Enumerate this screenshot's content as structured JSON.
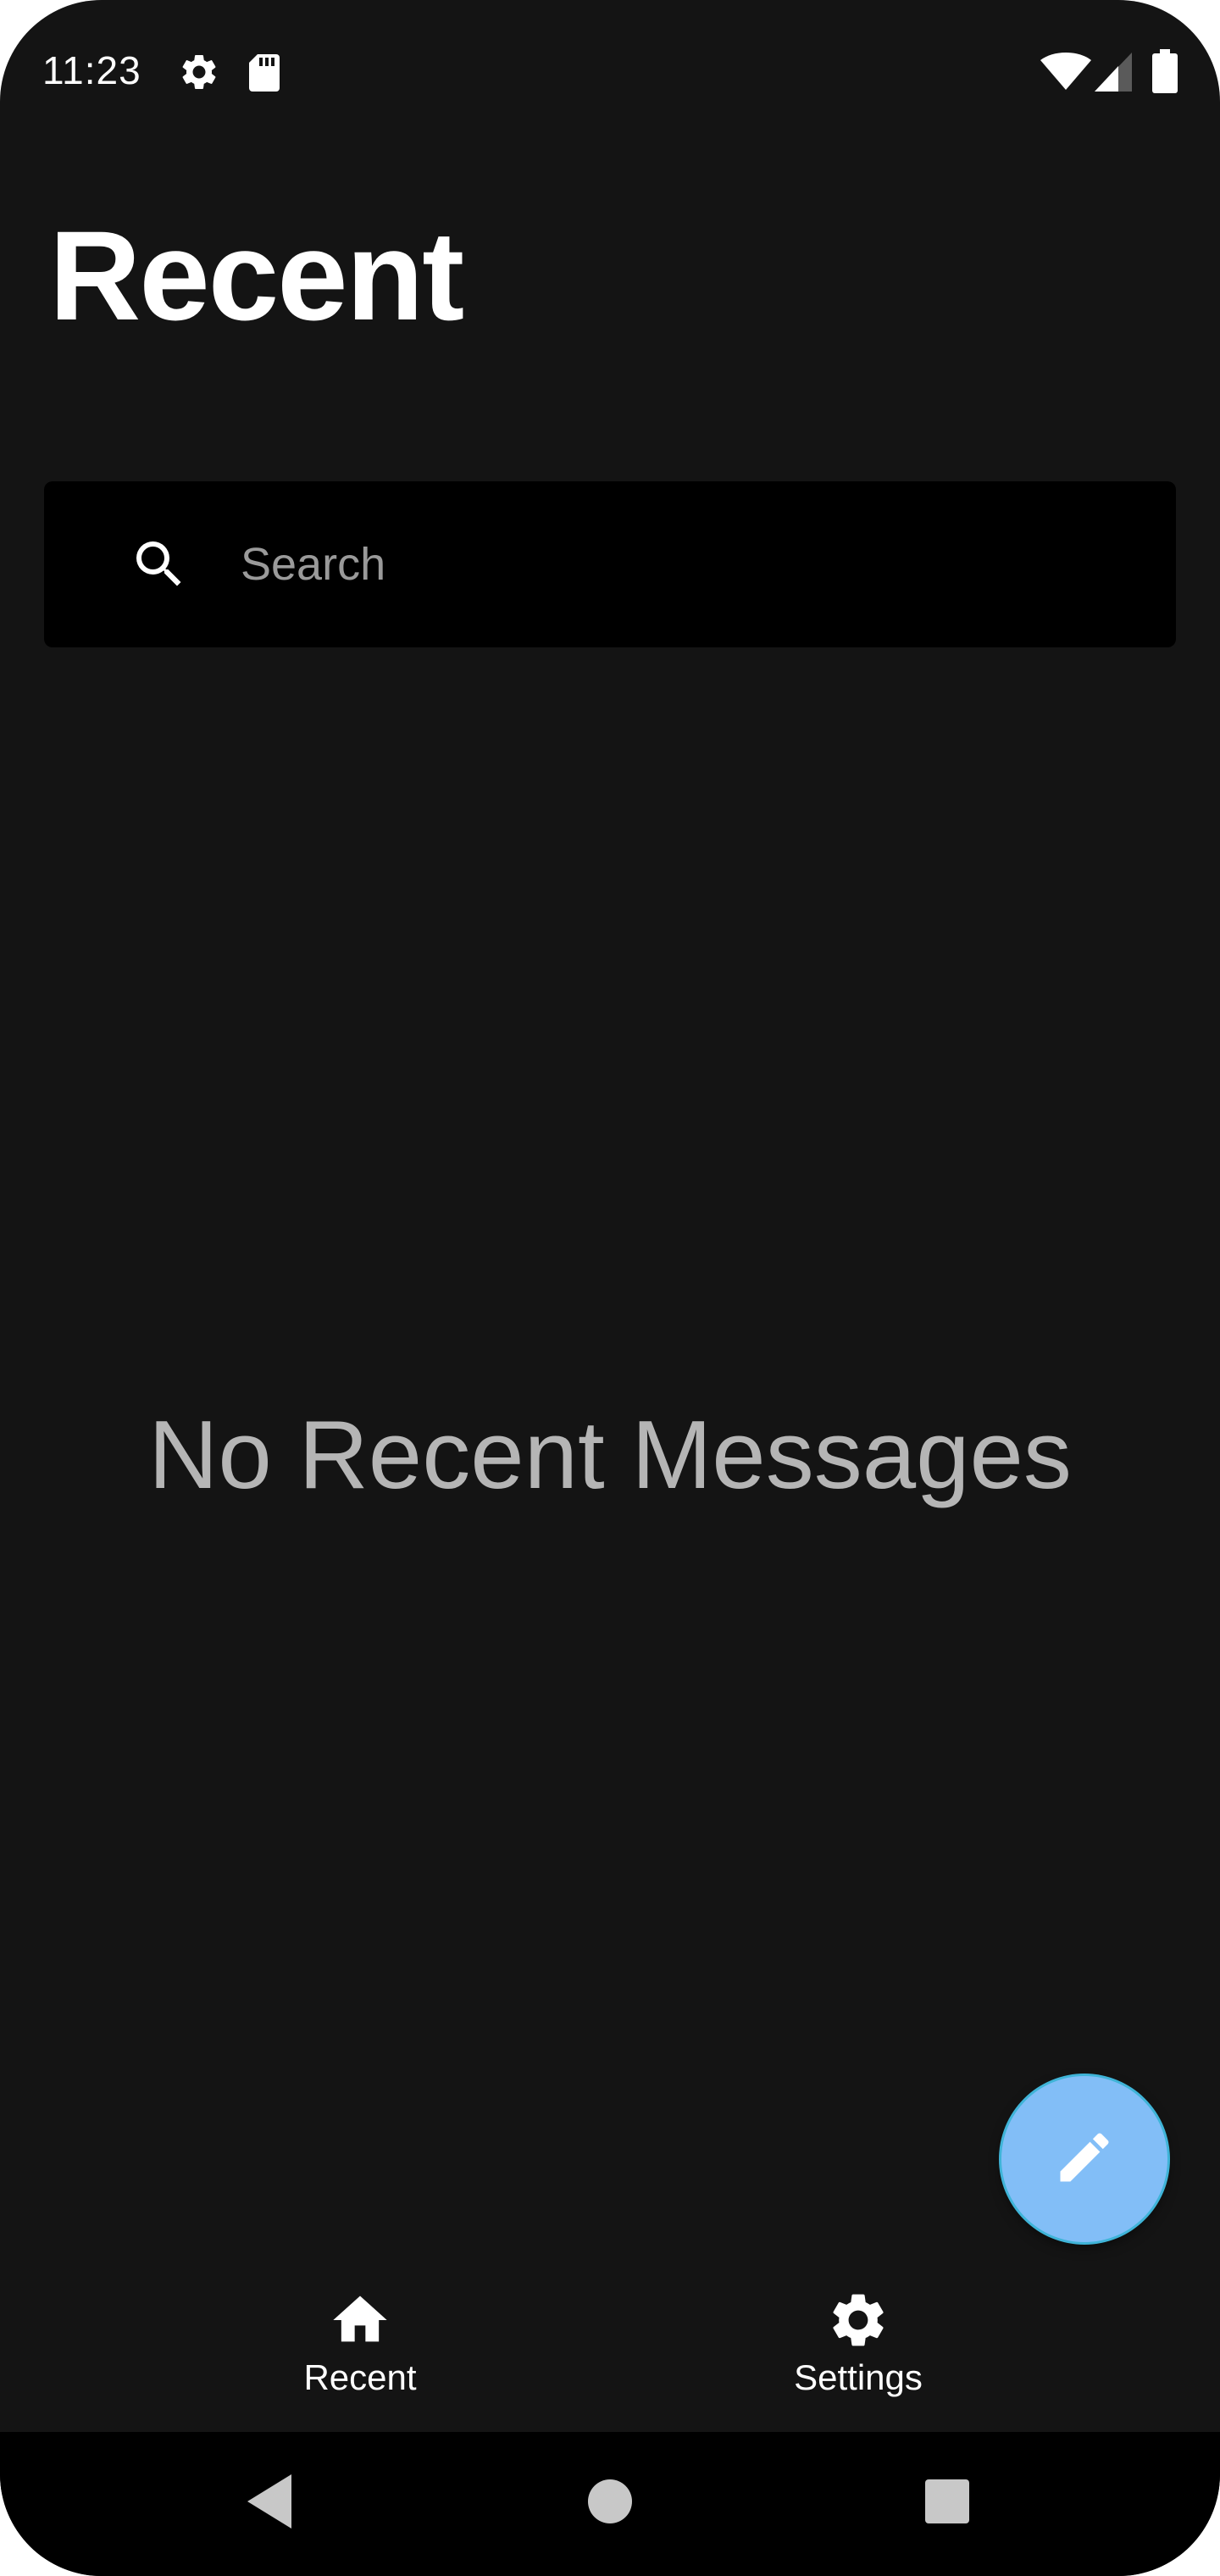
{
  "status_bar": {
    "time": "11:23",
    "icons": [
      "settings-gear-icon",
      "sd-card-icon",
      "wifi-icon",
      "cell-signal-icon",
      "battery-icon"
    ]
  },
  "header": {
    "title": "Recent"
  },
  "search": {
    "placeholder": "Search",
    "value": "",
    "icon": "search-icon"
  },
  "main": {
    "empty_message": "No Recent Messages"
  },
  "fab": {
    "icon": "pencil-icon",
    "color": "#82bef7"
  },
  "bottom_nav": {
    "items": [
      {
        "label": "Recent",
        "icon": "home-icon"
      },
      {
        "label": "Settings",
        "icon": "gear-icon"
      }
    ]
  },
  "system_nav": {
    "buttons": [
      "back-icon",
      "home-circle-icon",
      "recents-square-icon"
    ]
  },
  "colors": {
    "background": "#141414",
    "search_background": "#000000",
    "accent": "#82bef7",
    "secondary_text": "#b5b5b5"
  }
}
